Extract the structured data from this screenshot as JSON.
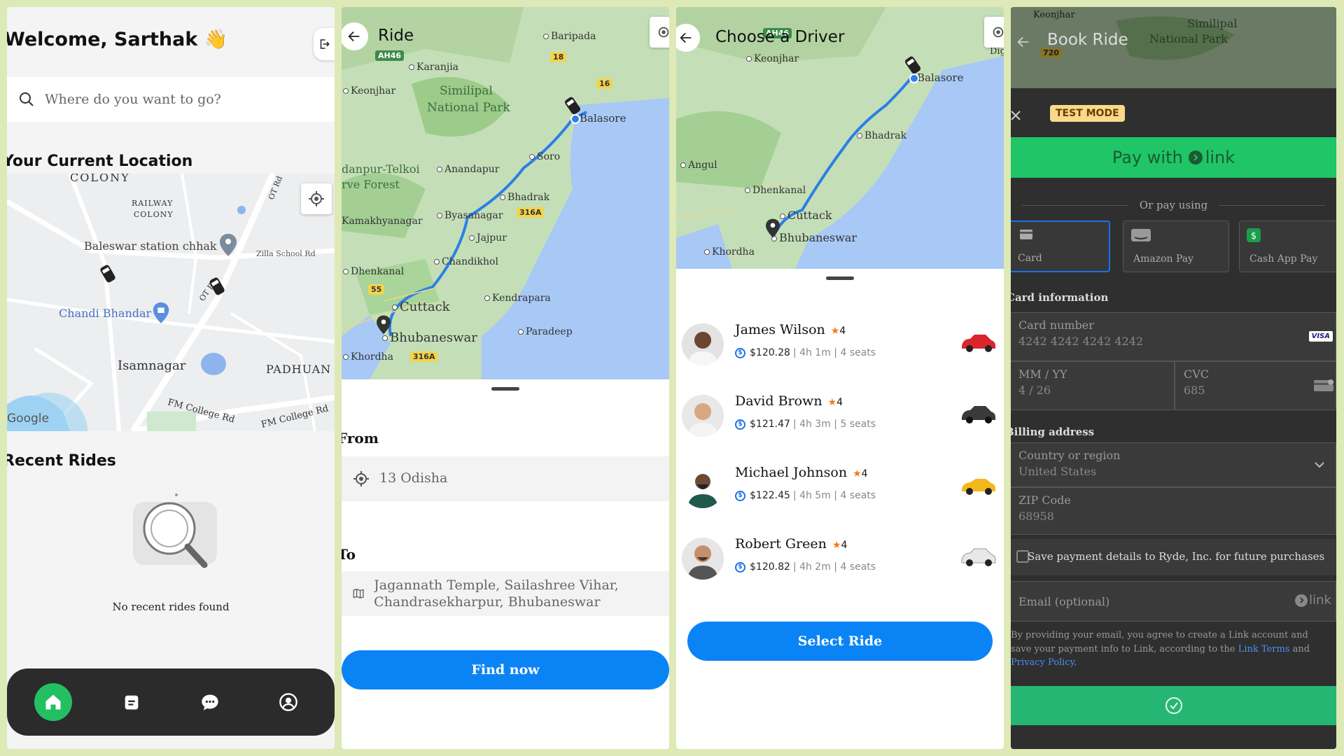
{
  "colors": {
    "background": "#dde9b6",
    "primary": "#0a84f4",
    "accent_green": "#22c063",
    "link_green": "#1fc566",
    "star": "#f07c1a"
  },
  "home": {
    "title": "Welcome, Sarthak 👋",
    "search_placeholder": "Where do you want to go?",
    "current_location_heading": "Your Current Location",
    "map_labels": [
      "COLONY",
      "RAILWAY",
      "COLONY",
      "Baleswar station chhak",
      "Zilla School Rd",
      "Chandi Bhandar",
      "Isamnagar",
      "PADHUAN",
      "FM College Rd",
      "FM College Rd",
      "OT Rd",
      "OT Rd",
      "Google"
    ],
    "recent_rides_heading": "Recent Rides",
    "empty_text": "No recent rides found",
    "nav_icons": [
      "home-icon",
      "rides-icon",
      "chat-icon",
      "profile-icon"
    ]
  },
  "ride": {
    "title": "Ride",
    "map_labels": {
      "baripada": "Baripada",
      "karanjia": "Karanjia",
      "keonjhar": "Keonjhar",
      "similipal": "Similipal",
      "national_park": "National Park",
      "balasore": "Balasore",
      "soro": "Soro",
      "forest1": "danpur-Telkoi",
      "forest2": "rve Forest",
      "anandapur": "Anandapur",
      "kamakhyanagar": "Kamakhyanagar",
      "byasanagar": "Byasanagar",
      "bhadrak": "Bhadrak",
      "jajpur": "Jajpur",
      "chandikhol": "Chandikhol",
      "dhenkanal": "Dhenkanal",
      "kendrapara": "Kendrapara",
      "cuttack": "Cuttack",
      "paradeep": "Paradeep",
      "bhubaneswar": "Bhubaneswar",
      "khordha": "Khordha"
    },
    "shields": {
      "ah46": "AH46",
      "n18": "18",
      "n16": "16",
      "n316a": "316A",
      "n55": "55",
      "n316a_2": "316A"
    },
    "from_label": "From",
    "from_value": "13 Odisha",
    "to_label": "To",
    "to_value": "Jagannath Temple, Sailashree Vihar, Chandrasekharpur, Bhubaneswar",
    "button": "Find now"
  },
  "driver": {
    "title": "Choose a Driver",
    "map_labels": {
      "keonjhar": "Keonjhar",
      "balasore": "Balasore",
      "bhadrak": "Bhadrak",
      "angul": "Angul",
      "dhenkanal": "Dhenkanal",
      "cuttack": "Cuttack",
      "bhubaneswar": "Bhubaneswar",
      "khordha": "Khordha",
      "dig": "Dig"
    },
    "shield": "AH46",
    "drivers": [
      {
        "name": "James Wilson",
        "rating": "4",
        "price": "$120.28",
        "details": "| 4h 1m | 4 seats",
        "car_color": "#d8262c"
      },
      {
        "name": "David Brown",
        "rating": "4",
        "price": "$121.47",
        "details": "| 4h 3m | 5 seats",
        "car_color": "#3a3a3a"
      },
      {
        "name": "Michael Johnson",
        "rating": "4",
        "price": "$122.45",
        "details": "| 4h 5m | 4 seats",
        "car_color": "#f2b81c"
      },
      {
        "name": "Robert Green",
        "rating": "4",
        "price": "$120.82",
        "details": "| 4h 2m | 4 seats",
        "car_color": "#e6e8ea"
      }
    ],
    "button": "Select Ride"
  },
  "payment": {
    "title": "Book Ride",
    "map_labels": {
      "keonjhar": "Keonjhar",
      "similipal": "Similipal",
      "national_park": "National Park",
      "n720": "720"
    },
    "test_mode": "TEST MODE",
    "pay_with": "Pay with",
    "link_word": "link",
    "or_pay_using": "Or pay using",
    "methods": [
      "Card",
      "Amazon Pay",
      "Cash App Pay"
    ],
    "card_info_label": "Card information",
    "card_number_label": "Card number",
    "card_number": "4242 4242 4242 4242",
    "card_brand": "VISA",
    "expiry_label": "MM / YY",
    "expiry": "4 / 26",
    "cvc_label": "CVC",
    "cvc": "685",
    "billing_label": "Billing address",
    "country_label": "Country or region",
    "country": "United States",
    "zip_label": "ZIP Code",
    "zip": "68958",
    "save_details": "Save payment details to Ryde, Inc. for future purchases",
    "email_placeholder": "Email (optional)",
    "legal_1": "By providing your email, you agree to create a Link account and save your payment info to Link, according to the ",
    "legal_link1": "Link Terms",
    "legal_and": " and ",
    "legal_link2": "Privacy Policy",
    "legal_end": "."
  }
}
